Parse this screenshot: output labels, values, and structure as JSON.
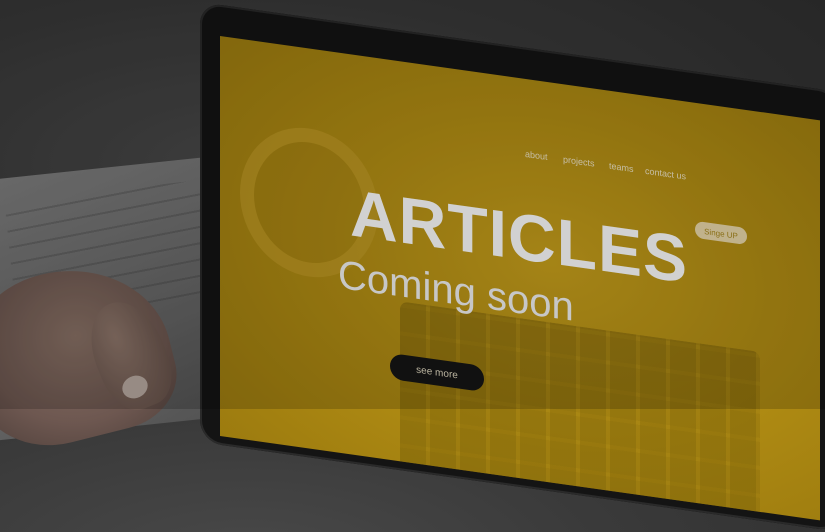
{
  "screen": {
    "nav": [
      "about",
      "projects",
      "teams",
      "contact us"
    ],
    "signup_label": "Singe UP",
    "title": "ARTICLES",
    "subtitle": "Coming soon",
    "see_more_label": "see more"
  },
  "colors": {
    "screen_accent": "#c9a11c",
    "button_dark": "#151515"
  }
}
